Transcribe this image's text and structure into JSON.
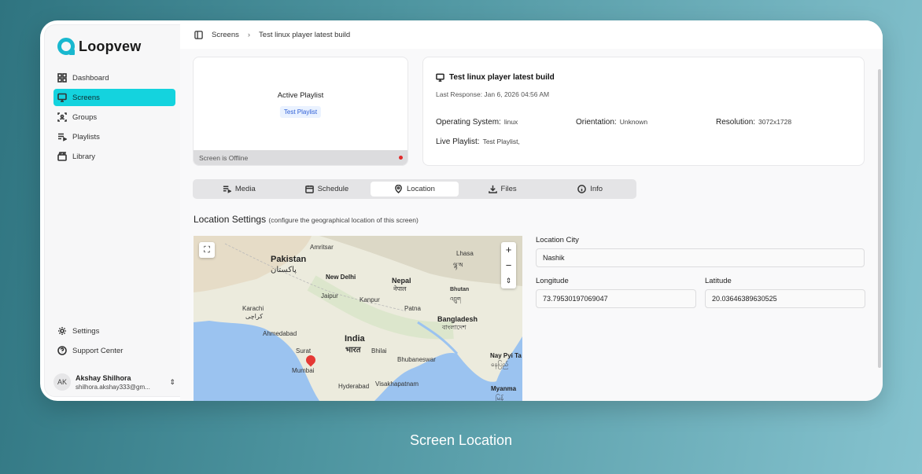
{
  "app": {
    "name": "Loopvew"
  },
  "sidebar": {
    "items": [
      {
        "label": "Dashboard",
        "icon": "dashboard-icon"
      },
      {
        "label": "Screens",
        "icon": "monitor-icon",
        "active": true
      },
      {
        "label": "Groups",
        "icon": "groups-icon"
      },
      {
        "label": "Playlists",
        "icon": "playlist-icon"
      },
      {
        "label": "Library",
        "icon": "library-icon"
      }
    ],
    "bottom": [
      {
        "label": "Settings",
        "icon": "gear-icon"
      },
      {
        "label": "Support Center",
        "icon": "help-icon"
      }
    ],
    "user": {
      "initials": "AK",
      "name": "Akshay Shilhora",
      "email": "shilhora.akshay333@gm..."
    }
  },
  "breadcrumb": {
    "root": "Screens",
    "current": "Test linux player latest build"
  },
  "playlist_card": {
    "title": "Active Playlist",
    "badge": "Test Playlist",
    "status": "Screen is Offline",
    "status_color": "#e02b2b"
  },
  "info_card": {
    "title": "Test linux player latest build",
    "last_response": "Last Response: Jan 6, 2026 04:56 AM",
    "os_label": "Operating System:",
    "os_value": "linux",
    "orientation_label": "Orientation:",
    "orientation_value": "Unknown",
    "resolution_label": "Resolution:",
    "resolution_value": "3072x1728",
    "live_label": "Live Playlist:",
    "live_value": "Test Playlist,"
  },
  "tabs": [
    {
      "label": "Media",
      "icon": "media-icon"
    },
    {
      "label": "Schedule",
      "icon": "calendar-icon"
    },
    {
      "label": "Location",
      "icon": "location-pin-icon",
      "active": true
    },
    {
      "label": "Files",
      "icon": "download-icon"
    },
    {
      "label": "Info",
      "icon": "info-icon"
    }
  ],
  "location": {
    "title": "Location Settings",
    "subtitle": "(configure the geographical location of this screen)",
    "city_label": "Location City",
    "city_value": "Nashik",
    "longitude_label": "Longitude",
    "longitude_value": "73.79530197069047",
    "latitude_label": "Latitude",
    "latitude_value": "20.03646389630525"
  },
  "map": {
    "labels": {
      "pakistan": "Pakistan",
      "pakistan_ur": "پاکستان",
      "amritsar": "Amritsar",
      "lhasa": "Lhasa",
      "lhasa_bo": "ལྷ་ས",
      "new_delhi": "New Delhi",
      "nepal": "Nepal",
      "nepal_ne": "नेपाल",
      "jaipur": "Jaipur",
      "kanpur": "Kanpur",
      "bhutan": "Bhutan",
      "bhutan_dz": "འབྲུག",
      "karachi": "Karachi",
      "karachi_ur": "کراچی",
      "patna": "Patna",
      "bangladesh": "Bangladesh",
      "bangladesh_bn": "বাংলাদেশ",
      "ahmedabad": "Ahmedabad",
      "india": "India",
      "india_hi": "भारत",
      "surat": "Surat",
      "bhilai": "Bhilai",
      "mumbai": "Mumbai",
      "bhubaneswar": "Bhubaneswar",
      "nay_pyi_taw": "Nay Pyi Ta",
      "nay_pyi_taw_my": "နေပြည်",
      "hyderabad": "Hyderabad",
      "visakhapatnam": "Visakhapatnam",
      "myanmar": "Myanma",
      "myanmar_my": "မြန်"
    },
    "zoom_in": "+",
    "zoom_out": "−",
    "compass": "⇕"
  },
  "caption": "Screen Location",
  "colors": {
    "accent": "#14d3de",
    "brand": "#19b8cf",
    "background": "#4e95a0"
  }
}
